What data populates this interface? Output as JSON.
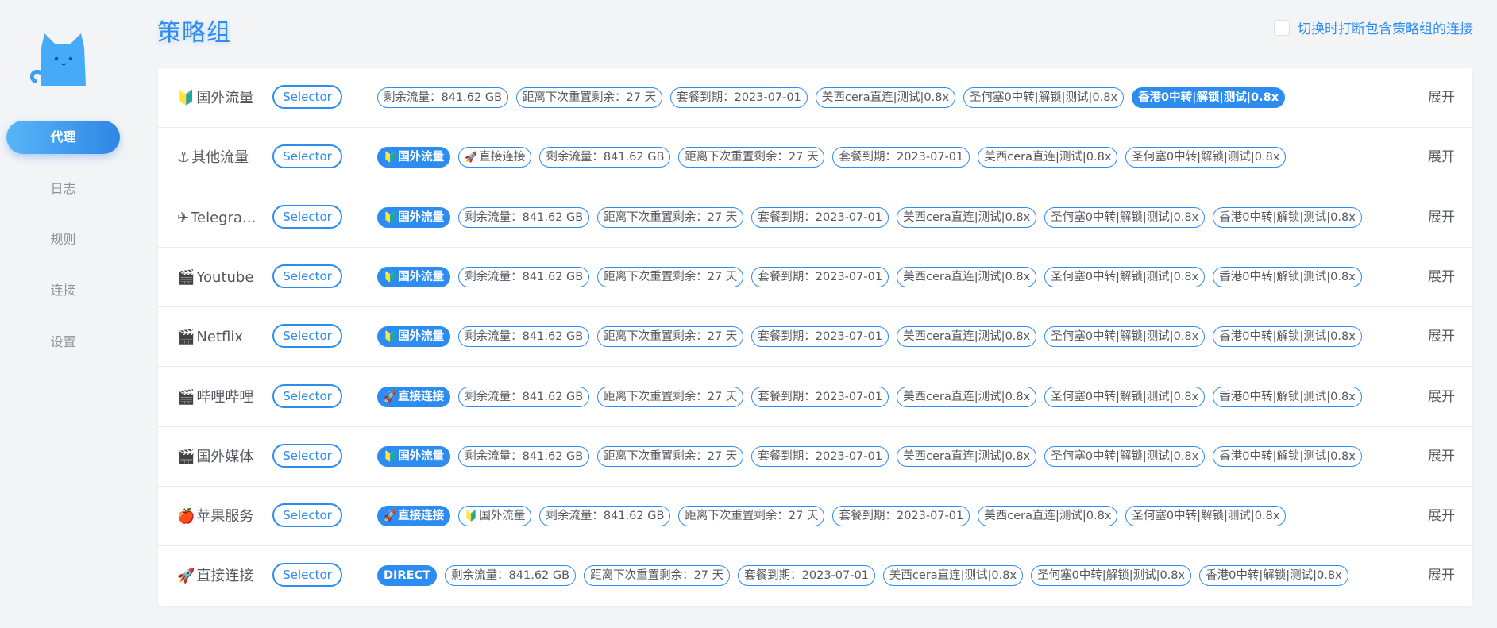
{
  "colors": {
    "accent": "#2d8cf0",
    "background": "#f3f4f6",
    "card": "#ffffff",
    "text": "#54595f",
    "muted": "#909399"
  },
  "sidebar": {
    "logo_icon": "cat-logo-icon",
    "items": [
      {
        "label": "代理",
        "active": true
      },
      {
        "label": "日志",
        "active": false
      },
      {
        "label": "规则",
        "active": false
      },
      {
        "label": "连接",
        "active": false
      },
      {
        "label": "设置",
        "active": false
      }
    ]
  },
  "header": {
    "title": "策略组",
    "toggle_label": "切换时打断包含策略组的连接",
    "toggle_checked": false
  },
  "expand_label": "展开",
  "groups": [
    {
      "icon": "🔰",
      "icon_name": "beginner-badge-icon",
      "name": "国外流量",
      "type": "Selector",
      "proxies": [
        {
          "label": "剩余流量：841.62 GB"
        },
        {
          "label": "距离下次重置剩余：27 天"
        },
        {
          "label": "套餐到期：2023-07-01"
        },
        {
          "label": "美西cera直连|测试|0.8x"
        },
        {
          "label": "圣何塞0中转|解锁|测试|0.8x"
        },
        {
          "label": "香港0中转|解锁|测试|0.8x",
          "selected": true
        }
      ]
    },
    {
      "icon": "⚓",
      "icon_name": "anchor-icon",
      "name": "其他流量",
      "type": "Selector",
      "proxies": [
        {
          "icon": "🔰",
          "label": "国外流量",
          "selected": true
        },
        {
          "icon": "🚀",
          "label": "直接连接"
        },
        {
          "label": "剩余流量：841.62 GB"
        },
        {
          "label": "距离下次重置剩余：27 天"
        },
        {
          "label": "套餐到期：2023-07-01"
        },
        {
          "label": "美西cera直连|测试|0.8x"
        },
        {
          "label": "圣何塞0中转|解锁|测试|0.8x"
        }
      ]
    },
    {
      "icon": "✈",
      "icon_name": "airplane-icon",
      "name": "Telegra...",
      "type": "Selector",
      "proxies": [
        {
          "icon": "🔰",
          "label": "国外流量",
          "selected": true
        },
        {
          "label": "剩余流量：841.62 GB"
        },
        {
          "label": "距离下次重置剩余：27 天"
        },
        {
          "label": "套餐到期：2023-07-01"
        },
        {
          "label": "美西cera直连|测试|0.8x"
        },
        {
          "label": "圣何塞0中转|解锁|测试|0.8x"
        },
        {
          "label": "香港0中转|解锁|测试|0.8x"
        }
      ]
    },
    {
      "icon": "🎬",
      "icon_name": "clapperboard-icon",
      "name": "Youtube",
      "type": "Selector",
      "proxies": [
        {
          "icon": "🔰",
          "label": "国外流量",
          "selected": true
        },
        {
          "label": "剩余流量：841.62 GB"
        },
        {
          "label": "距离下次重置剩余：27 天"
        },
        {
          "label": "套餐到期：2023-07-01"
        },
        {
          "label": "美西cera直连|测试|0.8x"
        },
        {
          "label": "圣何塞0中转|解锁|测试|0.8x"
        },
        {
          "label": "香港0中转|解锁|测试|0.8x"
        }
      ]
    },
    {
      "icon": "🎬",
      "icon_name": "clapperboard-icon",
      "name": "Netflix",
      "type": "Selector",
      "proxies": [
        {
          "icon": "🔰",
          "label": "国外流量",
          "selected": true
        },
        {
          "label": "剩余流量：841.62 GB"
        },
        {
          "label": "距离下次重置剩余：27 天"
        },
        {
          "label": "套餐到期：2023-07-01"
        },
        {
          "label": "美西cera直连|测试|0.8x"
        },
        {
          "label": "圣何塞0中转|解锁|测试|0.8x"
        },
        {
          "label": "香港0中转|解锁|测试|0.8x"
        }
      ]
    },
    {
      "icon": "🎬",
      "icon_name": "clapperboard-icon",
      "name": "哔哩哔哩",
      "type": "Selector",
      "proxies": [
        {
          "icon": "🚀",
          "label": "直接连接",
          "selected": true
        },
        {
          "label": "剩余流量：841.62 GB"
        },
        {
          "label": "距离下次重置剩余：27 天"
        },
        {
          "label": "套餐到期：2023-07-01"
        },
        {
          "label": "美西cera直连|测试|0.8x"
        },
        {
          "label": "圣何塞0中转|解锁|测试|0.8x"
        },
        {
          "label": "香港0中转|解锁|测试|0.8x"
        }
      ]
    },
    {
      "icon": "🎬",
      "icon_name": "clapperboard-icon",
      "name": "国外媒体",
      "type": "Selector",
      "proxies": [
        {
          "icon": "🔰",
          "label": "国外流量",
          "selected": true
        },
        {
          "label": "剩余流量：841.62 GB"
        },
        {
          "label": "距离下次重置剩余：27 天"
        },
        {
          "label": "套餐到期：2023-07-01"
        },
        {
          "label": "美西cera直连|测试|0.8x"
        },
        {
          "label": "圣何塞0中转|解锁|测试|0.8x"
        },
        {
          "label": "香港0中转|解锁|测试|0.8x"
        }
      ]
    },
    {
      "icon": "🍎",
      "icon_name": "apple-icon",
      "name": "苹果服务",
      "type": "Selector",
      "proxies": [
        {
          "icon": "🚀",
          "label": "直接连接",
          "selected": true
        },
        {
          "icon": "🔰",
          "label": "国外流量"
        },
        {
          "label": "剩余流量：841.62 GB"
        },
        {
          "label": "距离下次重置剩余：27 天"
        },
        {
          "label": "套餐到期：2023-07-01"
        },
        {
          "label": "美西cera直连|测试|0.8x"
        },
        {
          "label": "圣何塞0中转|解锁|测试|0.8x"
        }
      ]
    },
    {
      "icon": "🚀",
      "icon_name": "rocket-icon",
      "name": "直接连接",
      "type": "Selector",
      "proxies": [
        {
          "label": "DIRECT",
          "selected": true
        },
        {
          "label": "剩余流量：841.62 GB"
        },
        {
          "label": "距离下次重置剩余：27 天"
        },
        {
          "label": "套餐到期：2023-07-01"
        },
        {
          "label": "美西cera直连|测试|0.8x"
        },
        {
          "label": "圣何塞0中转|解锁|测试|0.8x"
        },
        {
          "label": "香港0中转|解锁|测试|0.8x"
        }
      ]
    }
  ]
}
